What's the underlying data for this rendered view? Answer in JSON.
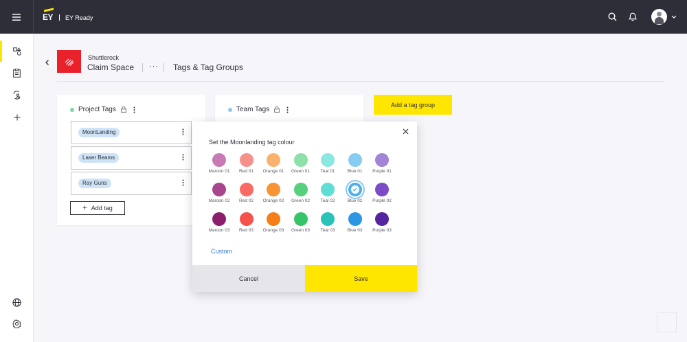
{
  "app": {
    "brand_logo": "EY",
    "brand_name": "EY Ready",
    "colors": {
      "topbar": "#2e2e38",
      "accent": "#ffe600",
      "link": "#2f7bd1",
      "chip": "#cfe3f7"
    }
  },
  "topbar": {
    "icons": [
      "hamburger-menu-icon",
      "search-icon",
      "bell-icon",
      "avatar",
      "chevron-down-icon"
    ]
  },
  "sidenav": {
    "items": [
      {
        "icon": "shapes-icon",
        "active": true
      },
      {
        "icon": "clipboard-icon",
        "active": false
      },
      {
        "icon": "user-search-icon",
        "active": false
      },
      {
        "icon": "plus-icon",
        "active": false
      },
      {
        "icon": "globe-icon",
        "active": false
      },
      {
        "icon": "gear-icon",
        "active": false
      }
    ]
  },
  "header": {
    "space_subtitle": "Shuttlerock",
    "space_title": "Claim Space",
    "more": "···",
    "page_title": "Tags & Tag Groups"
  },
  "panels": {
    "project": {
      "title": "Project Tags",
      "dot_color": "#7fd6a4",
      "tags": [
        "MoonLanding",
        "Laser Beams",
        "Ray Guns"
      ],
      "add_label": "Add tag"
    },
    "team": {
      "title": "Team Tags",
      "dot_color": "#8cc9e8"
    },
    "add_group_label": "Add a tag group"
  },
  "modal": {
    "title": "Set the Moonlanding tag colour",
    "swatches": [
      {
        "label": "Maroon 01",
        "color": "#c87bb2"
      },
      {
        "label": "Red 01",
        "color": "#f78f8a"
      },
      {
        "label": "Orange 01",
        "color": "#f9b26b"
      },
      {
        "label": "Green 01",
        "color": "#8de0a8"
      },
      {
        "label": "Teal 01",
        "color": "#8ae8e0"
      },
      {
        "label": "Blue 01",
        "color": "#86ccf0"
      },
      {
        "label": "Purple 01",
        "color": "#a184d6"
      },
      {
        "label": "Maroon 02",
        "color": "#a9448f"
      },
      {
        "label": "Red 02",
        "color": "#f86b63"
      },
      {
        "label": "Orange 02",
        "color": "#f89434"
      },
      {
        "label": "Green 02",
        "color": "#56d07c"
      },
      {
        "label": "Teal 02",
        "color": "#5ddfd6"
      },
      {
        "label": "Blue 02",
        "color": "#4eb0ec",
        "selected": true
      },
      {
        "label": "Purple 02",
        "color": "#7c4cc7"
      },
      {
        "label": "Maroon 03",
        "color": "#8c1f6c"
      },
      {
        "label": "Red 03",
        "color": "#f6524c"
      },
      {
        "label": "Orange 03",
        "color": "#f57f16"
      },
      {
        "label": "Green 03",
        "color": "#37c368"
      },
      {
        "label": "Teal 03",
        "color": "#2bc2b8"
      },
      {
        "label": "Blue 03",
        "color": "#2b97e3"
      },
      {
        "label": "Purple 03",
        "color": "#55249f"
      }
    ],
    "custom_label": "Custom",
    "cancel_label": "Cancel",
    "save_label": "Save"
  }
}
